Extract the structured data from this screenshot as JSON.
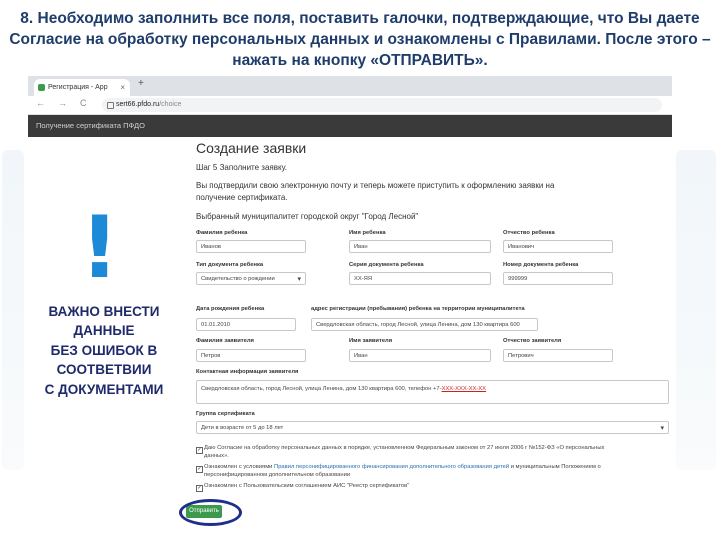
{
  "slide": {
    "title": "8. Необходимо заполнить все поля, поставить галочки, подтверждающие, что Вы даете Согласие на обработку персональных данных и ознакомлены с Правилами. После этого – нажать на кнопку «ОТПРАВИТЬ».",
    "callout_mark": "!",
    "callout_lines": [
      "ВАЖНО ВНЕСТИ",
      "ДАННЫЕ",
      "БЕЗ ОШИБОК В",
      "СООТВЕТВИИ",
      "С ДОКУМЕНТАМИ"
    ]
  },
  "browser": {
    "tab_title": "Регистрация - Арр",
    "tab_close": "×",
    "new_tab": "+",
    "back": "←",
    "forward": "→",
    "reload": "C",
    "url_host": "sert66.pfdo.ru",
    "url_path": "/choice"
  },
  "site": {
    "header": "Получение сертификата ПФДО"
  },
  "form": {
    "title": "Создание заявки",
    "step": "Шаг 5 Заполните заявку.",
    "intro_1": "Вы подтвердили свою электронную почту и теперь можете приступить к оформлению заявки на",
    "intro_2": "получение сертификата.",
    "municipality": "Выбранный муниципалитет городской округ \"Город Лесной\"",
    "child_lastname": {
      "label": "Фамилия ребенка",
      "value": "Иванов"
    },
    "child_firstname": {
      "label": "Имя ребенка",
      "value": "Иван"
    },
    "child_patronymic": {
      "label": "Отчество ребенка",
      "value": "Иванович"
    },
    "doc_type": {
      "label": "Тип документа ребенка",
      "value": "Свидетельство о рождении"
    },
    "doc_series": {
      "label": "Серия документа ребенка",
      "value": "XX-ЯЯ"
    },
    "doc_number": {
      "label": "Номер документа ребенка",
      "value": "999999"
    },
    "birth_date": {
      "label": "Дата рождения ребенка",
      "value": "01.01.2010"
    },
    "address": {
      "label": "адрес регистрации (пребывания) ребенка на территории муниципалитета",
      "value": "Свердловская область, город Лесной, улица Ленина, дом 130 квартира 600"
    },
    "applicant_lastname": {
      "label": "Фамилия заявителя",
      "value": "Петров"
    },
    "applicant_firstname": {
      "label": "Имя заявителя",
      "value": "Иван"
    },
    "applicant_patronymic": {
      "label": "Отчество заявителя",
      "value": "Петрович"
    },
    "contact": {
      "label": "Контактная информация заявителя",
      "value": "Свердловская область, город Лесной, улица Ленина, дом 130 квартира 600, телефон +7-",
      "phone_mask": "XXX-XXX-XX-XX"
    },
    "cert_group": {
      "label": "Группа сертификата",
      "value": "Дети в возрасте от 5 до 18 лет"
    },
    "consents": [
      {
        "check": "✓",
        "line1_text": "Даю Согласие на обработку персональных данных в порядке, установленном Федеральным законом от 27 июля 2006 г №152-ФЗ «О персональных",
        "line2_text": "данных»."
      },
      {
        "check": "✓",
        "line1_text": "Ознакомлен с условиями ",
        "line1_link": "Правил персонифицированного финансирования дополнительного образования детей",
        "line1_tail": " и муниципальным Положением о",
        "line2_text": "персонифицированном дополнительном образовании"
      },
      {
        "check": "✓",
        "line1_text": "Ознакомлен с Пользовательским соглашением АИС \"Реестр сертификатов\""
      }
    ],
    "submit": "Отправить"
  },
  "colors": {
    "title_text": "#1f3d6b",
    "accent_blue": "#1d8ad8",
    "callout_text": "#1f2a6a",
    "submit_green": "#3b9a4c",
    "highlight_ring": "#1d2f8a",
    "site_header_bg": "#3a3a3a"
  }
}
